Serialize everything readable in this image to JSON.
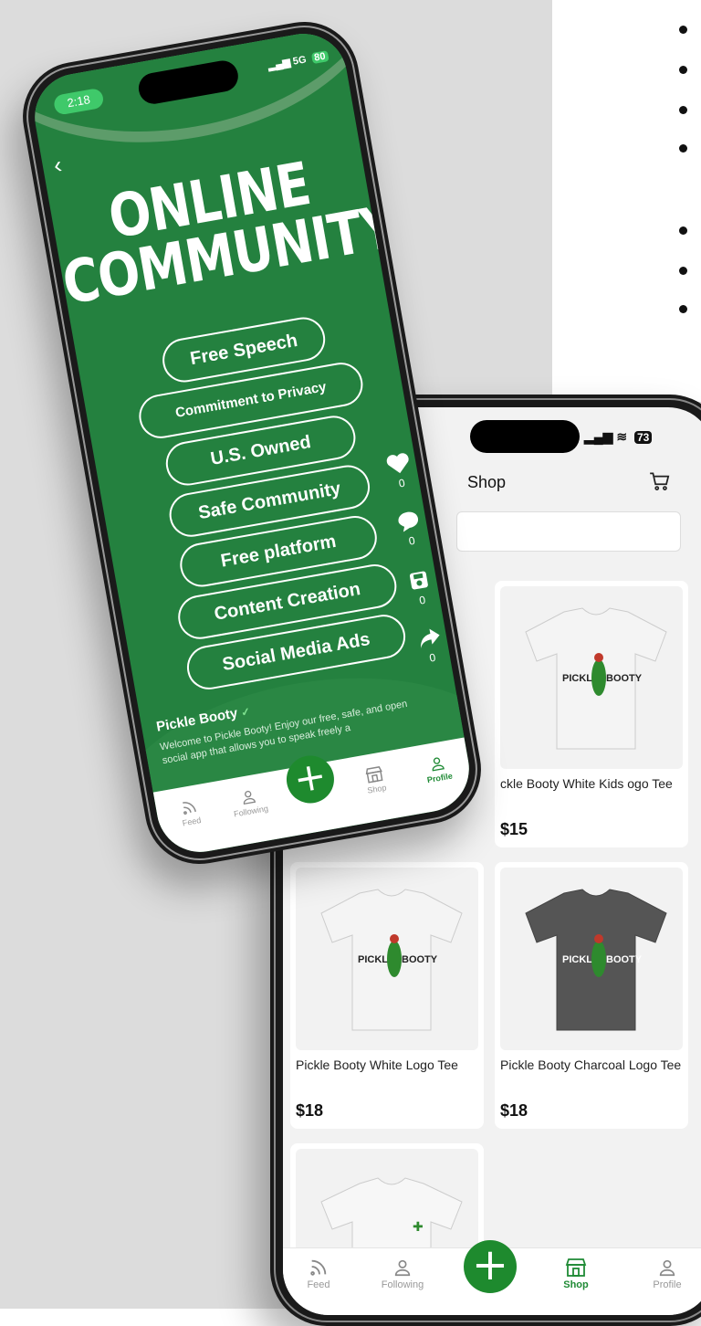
{
  "community_screen": {
    "status_time": "2:18",
    "signal": "5G",
    "battery": "80",
    "headline_line1": "ONLINE",
    "headline_line2": "COMMUNITY",
    "pills": [
      "Free Speech",
      "Commitment to Privacy",
      "U.S. Owned",
      "Safe Community",
      "Free platform",
      "Content Creation",
      "Social Media Ads"
    ],
    "actions": [
      {
        "icon": "heart-icon",
        "count": "0"
      },
      {
        "icon": "comment-icon",
        "count": "0"
      },
      {
        "icon": "save-icon",
        "count": "0"
      },
      {
        "icon": "share-icon",
        "count": "0"
      }
    ],
    "author": "Pickle Booty",
    "description": "Welcome to Pickle Booty! Enjoy our free, safe, and open social app that allows you to speak freely a",
    "nav": {
      "feed": "Feed",
      "following": "Following",
      "shop": "Shop",
      "profile": "Profile"
    },
    "accent": "#24813f"
  },
  "shop_screen": {
    "battery": "73",
    "title": "Shop",
    "products": [
      {
        "name": "ckle Booty White Kids ogo Tee",
        "price": "$15",
        "shirt_color": "#f2f2f2"
      },
      {
        "name": "Pickle Booty White Logo Tee",
        "price": "$18",
        "shirt_color": "#f2f2f2"
      },
      {
        "name": "Pickle Booty Charcoal Logo Tee",
        "price": "$18",
        "shirt_color": "#555555"
      }
    ],
    "shirt_print": {
      "left": "PICKLE",
      "right": "BOOTY"
    },
    "nav": {
      "feed": "Feed",
      "following": "Following",
      "shop": "Shop",
      "profile": "Profile"
    },
    "active_color": "#1f8a35"
  }
}
